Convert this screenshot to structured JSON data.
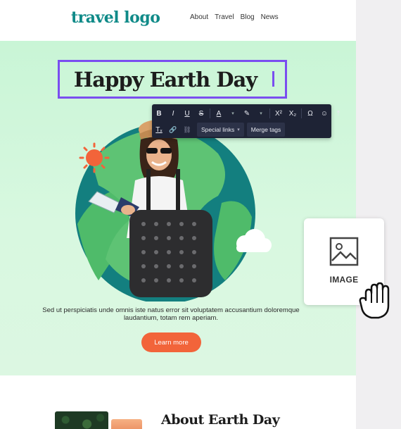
{
  "header": {
    "logo": "travel logo",
    "nav": [
      "About",
      "Travel",
      "Blog",
      "News"
    ]
  },
  "hero": {
    "headline": "Happy Earth Day",
    "body": "Sed ut perspiciatis unde omnis iste natus error sit voluptatem accusantium doloremque laudantium, totam rem aperiam.",
    "cta_label": "Learn more"
  },
  "toolbar": {
    "row1": [
      {
        "name": "bold-button",
        "glyph": "B"
      },
      {
        "name": "italic-button",
        "glyph": "I"
      },
      {
        "name": "underline-button",
        "glyph": "U"
      },
      {
        "name": "strikethrough-button",
        "glyph": "S"
      },
      {
        "name": "text-color-button",
        "glyph": "A"
      },
      {
        "name": "highlight-button",
        "glyph": "✎"
      },
      {
        "name": "superscript-button",
        "glyph": "X²"
      },
      {
        "name": "subscript-button",
        "glyph": "X₂"
      },
      {
        "name": "special-char-button",
        "glyph": "Ω"
      },
      {
        "name": "emoji-button",
        "glyph": "☺"
      },
      {
        "name": "upload-button",
        "glyph": "⤒"
      }
    ],
    "row2": [
      {
        "name": "clear-format-button",
        "glyph": "Tₓ"
      },
      {
        "name": "link-button",
        "glyph": "🔗"
      },
      {
        "name": "unlink-button",
        "glyph": "⛓"
      }
    ],
    "special_links_label": "Special links",
    "merge_tags_label": "Merge tags"
  },
  "image_block": {
    "label": "IMAGE"
  },
  "about": {
    "title": "About Earth Day"
  },
  "colors": {
    "logo": "#0f8a88",
    "selection": "#7a4ef0",
    "cta": "#f2643a",
    "toolbar": "#1e2335"
  }
}
